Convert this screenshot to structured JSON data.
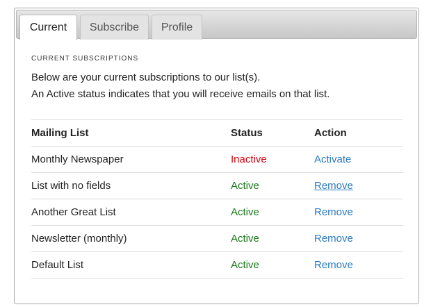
{
  "tabs": [
    {
      "label": "Current",
      "active": true
    },
    {
      "label": "Subscribe",
      "active": false
    },
    {
      "label": "Profile",
      "active": false
    }
  ],
  "section": {
    "title": "CURRENT SUBSCRIPTIONS",
    "line1": "Below are your current subscriptions to our list(s).",
    "line2": "An Active status indicates that you will receive emails on that list."
  },
  "table": {
    "headers": [
      "Mailing List",
      "Status",
      "Action"
    ],
    "rows": [
      {
        "list": "Monthly Newspaper",
        "status": "Inactive",
        "action": "Activate"
      },
      {
        "list": "List with no fields",
        "status": "Active",
        "action": "Remove"
      },
      {
        "list": "Another Great List",
        "status": "Active",
        "action": "Remove"
      },
      {
        "list": "Newsletter (monthly)",
        "status": "Active",
        "action": "Remove"
      },
      {
        "list": "Default List",
        "status": "Active",
        "action": "Remove"
      }
    ]
  },
  "colors": {
    "inactive": "#d9000d",
    "active": "#1a7a1a",
    "link": "#2a7ac2"
  }
}
